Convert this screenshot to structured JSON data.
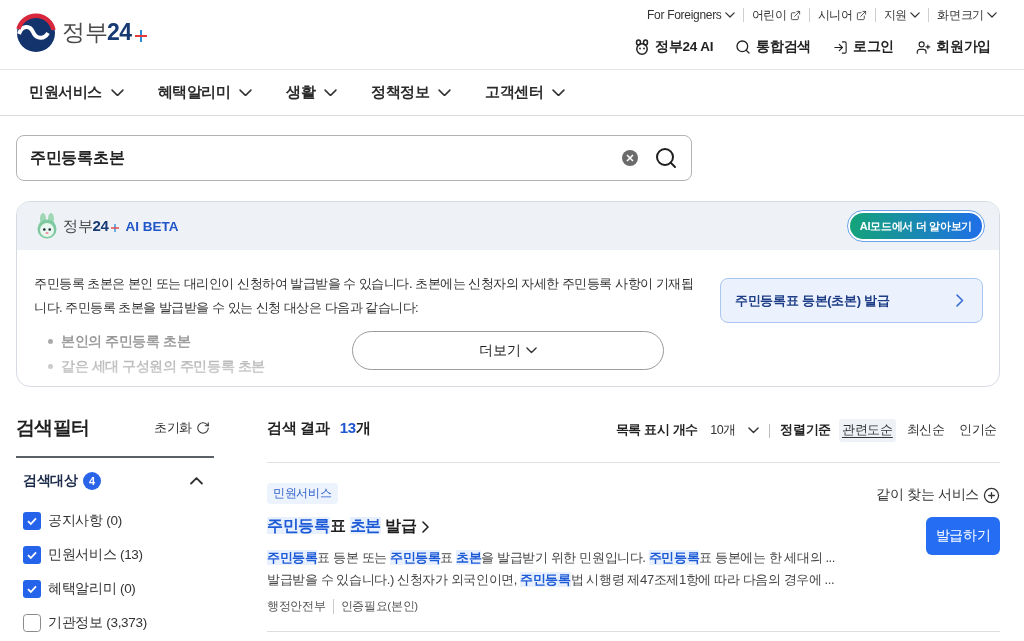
{
  "header": {
    "logo": {
      "text": "정부",
      "accent": "24"
    },
    "utility_links": [
      {
        "label": "For Foreigners",
        "kind": "menu"
      },
      {
        "label": "어린이",
        "kind": "external"
      },
      {
        "label": "시니어",
        "kind": "external"
      },
      {
        "label": "지원",
        "kind": "menu"
      },
      {
        "label": "화면크기",
        "kind": "menu"
      }
    ],
    "actions": [
      {
        "label": "정부24 AI",
        "kind": "ai"
      },
      {
        "label": "통합검색",
        "kind": "search"
      },
      {
        "label": "로그인",
        "kind": "login"
      },
      {
        "label": "회원가입",
        "kind": "signup"
      }
    ]
  },
  "nav": [
    {
      "label": "민원서비스"
    },
    {
      "label": "혜택알리미"
    },
    {
      "label": "생활"
    },
    {
      "label": "정책정보"
    },
    {
      "label": "고객센터"
    }
  ],
  "search": {
    "value": "주민등록초본"
  },
  "ai_panel": {
    "brand": {
      "text": "정부",
      "accent": "24"
    },
    "badge": "AI BETA",
    "mode_button": "AI모드에서 더 알아보기",
    "summary": "주민등록 초본은 본인 또는 대리인이 신청하여 발급받을 수 있습니다. 초본에는 신청자의 자세한 주민등록 사항이 기재됩니다. 주민등록 초본을 발급받을 수 있는 신청 대상은 다음과 같습니다:",
    "bullets": [
      "본인의 주민등록 초본",
      "같은 세대 구성원의 주민등록 초본"
    ],
    "more_button": "더보기",
    "service_link": "주민등록표 등본(초본) 발급"
  },
  "filter": {
    "title": "검색필터",
    "reset": "초기화",
    "group": {
      "label": "검색대상",
      "count": "4",
      "expanded": true,
      "options": [
        {
          "label": "공지사항 (0)",
          "checked": true
        },
        {
          "label": "민원서비스 (13)",
          "checked": true
        },
        {
          "label": "혜택알리미 (0)",
          "checked": true
        },
        {
          "label": "기관정보 (3,373)",
          "checked": false
        }
      ]
    }
  },
  "results": {
    "title": "검색 결과",
    "count": "13",
    "count_unit": "개",
    "page_size_label": "목록 표시 개수",
    "page_size": "10개",
    "sort_label": "정렬기준",
    "sort_options": [
      {
        "label": "관련도순",
        "selected": true
      },
      {
        "label": "최신순",
        "selected": false
      },
      {
        "label": "인기순",
        "selected": false
      }
    ],
    "items": [
      {
        "category": "민원서비스",
        "related": "같이 찾는 서비스",
        "title": "**주민등록**표 **초본** 발급",
        "description": "**주민등록**표 등본 또는 **주민등록**표 **초본**을 발급받기 위한 민원입니다. **주민등록**표 등본에는 한 세대의 ... 발급받을 수 있습니다.) 신청자가 외국인이면, **주민등록**법 시행령 제47조제1항에 따라 다음의 경우에 ...",
        "meta": [
          "행정안전부",
          "인증필요(본인)"
        ],
        "action": "발급하기"
      }
    ]
  }
}
